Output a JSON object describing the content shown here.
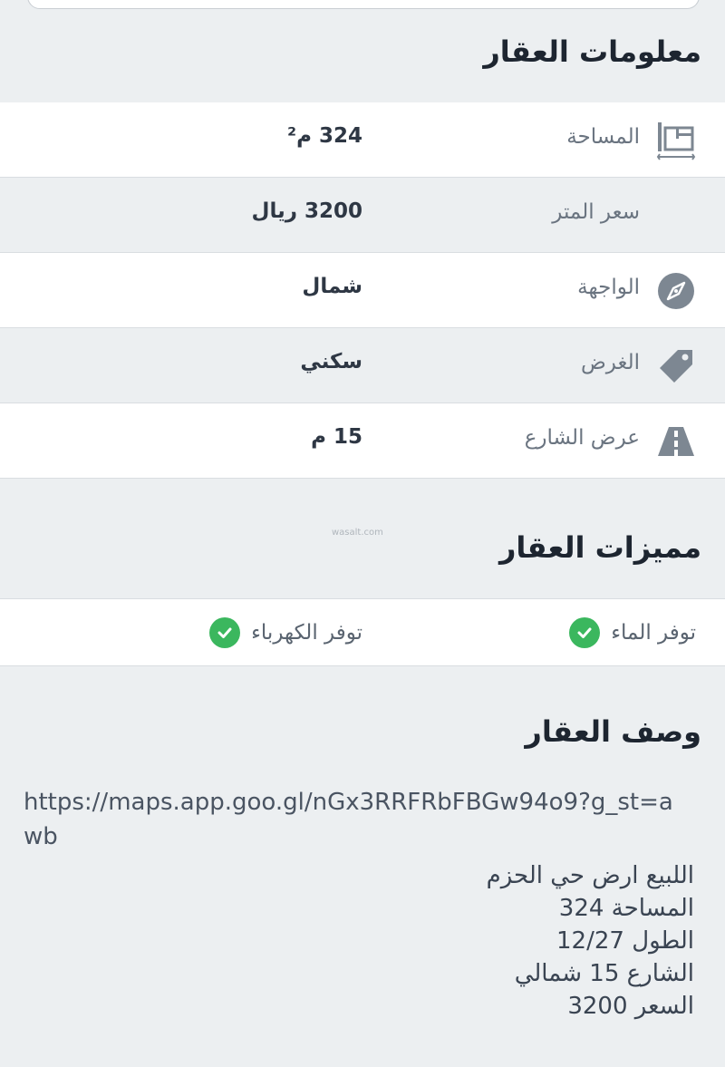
{
  "info_section": {
    "title": "معلومات العقار",
    "rows": [
      {
        "icon": "area-ruler-icon",
        "label": "المساحة",
        "value": "324 م²"
      },
      {
        "icon": "",
        "label": "سعر المتر",
        "value": "3200 ريال"
      },
      {
        "icon": "compass-icon",
        "label": "الواجهة",
        "value": "شمال"
      },
      {
        "icon": "tag-icon",
        "label": "الغرض",
        "value": "سكني"
      },
      {
        "icon": "road-icon",
        "label": "عرض الشارع",
        "value": "15 م"
      }
    ]
  },
  "watermark": "wasalt.com",
  "features_section": {
    "title": "مميزات العقار",
    "items": [
      {
        "label": "توفر الماء",
        "icon": "check-circle-icon"
      },
      {
        "label": "توفر الكهرباء",
        "icon": "check-circle-icon"
      }
    ]
  },
  "description_section": {
    "title": "وصف العقار",
    "link": "https://maps.app.goo.gl/nGx3RRFRbFBGw94o9?g_st=awb",
    "lines": [
      "اللبيع ارض حي الحزم",
      "المساحة 324",
      "الطول 12/27",
      "الشارع 15 شمالي",
      "السعر 3200"
    ]
  },
  "colors": {
    "background": "#eceff1",
    "row_white": "#ffffff",
    "check_green": "#3bb75e",
    "icon_grey": "#7d8792"
  }
}
